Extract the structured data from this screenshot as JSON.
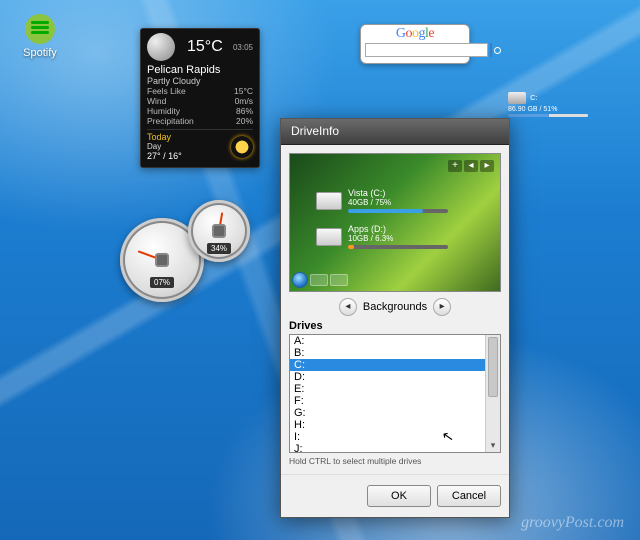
{
  "desktop": {
    "spotify_label": "Spotify"
  },
  "weather": {
    "time": "03:05",
    "temp": "15°C",
    "location": "Pelican Rapids",
    "condition": "Partly Cloudy",
    "rows": [
      {
        "k": "Feels Like",
        "v": "15°C"
      },
      {
        "k": "Wind",
        "v": "0m/s"
      },
      {
        "k": "Humidity",
        "v": "86%"
      },
      {
        "k": "Precipitation",
        "v": "20%"
      }
    ],
    "today_label": "Today",
    "day_label": "Day",
    "hi_lo": "27° / 16°"
  },
  "google": {
    "letters": [
      "G",
      "o",
      "o",
      "g",
      "l",
      "e"
    ],
    "placeholder": ""
  },
  "minidrive": {
    "label": "C:",
    "stat": "86.90 GB / 51%"
  },
  "gauges": {
    "big": "07%",
    "small": "34%"
  },
  "driveinfo": {
    "title": "DriveInfo",
    "controls": {
      "plus": "+",
      "prev": "◂",
      "next": "▸"
    },
    "drives_preview": [
      {
        "name": "Vista (C:)",
        "stat": "40GB / 75%",
        "pct": 75,
        "color": "#39a0e8"
      },
      {
        "name": "Apps (D:)",
        "stat": "10GB / 6.3%",
        "pct": 6,
        "color": "#ff9a1a"
      }
    ],
    "bg_label": "Backgrounds",
    "drives_label": "Drives",
    "drive_letters": [
      "A:",
      "B:",
      "C:",
      "D:",
      "E:",
      "F:",
      "G:",
      "H:",
      "I:",
      "J:"
    ],
    "selected": "C:",
    "hint": "Hold CTRL to select multiple drives",
    "ok": "OK",
    "cancel": "Cancel"
  },
  "watermark": "groovyPost.com"
}
